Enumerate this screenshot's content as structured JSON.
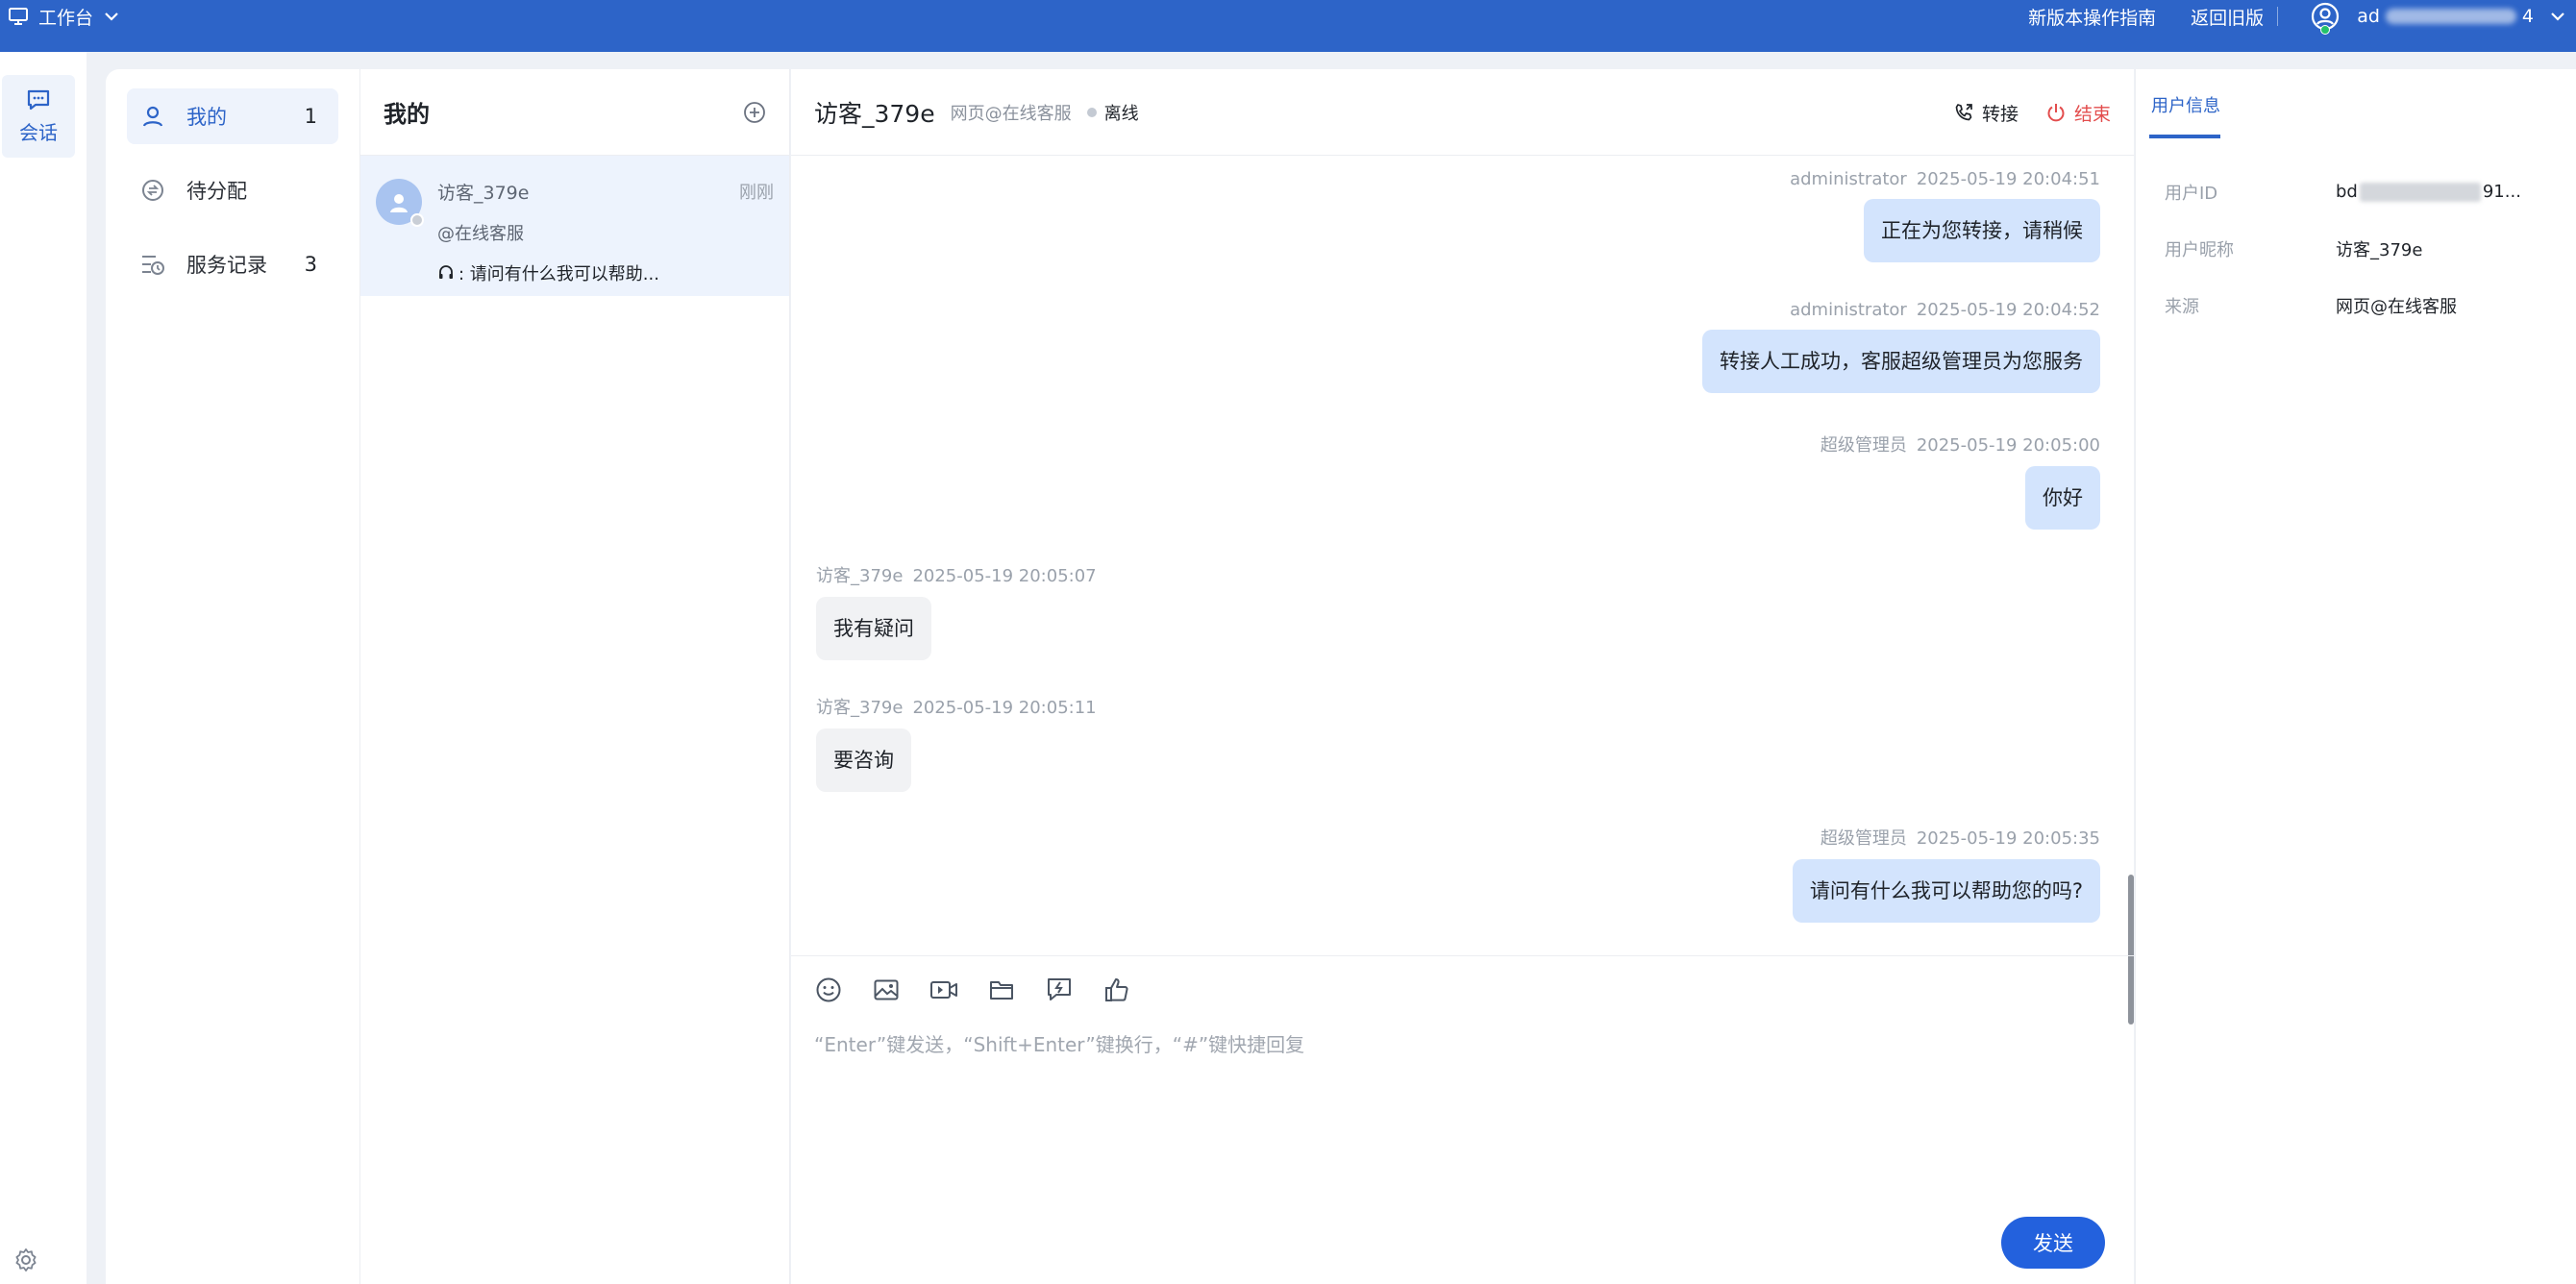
{
  "topbar": {
    "workspace_label": "工作台",
    "guide_link": "新版本操作指南",
    "old_version_link": "返回旧版",
    "user_prefix": "ad",
    "user_suffix": "4"
  },
  "rail": {
    "session_label": "会话"
  },
  "menu": {
    "items": [
      {
        "label": "我的",
        "count": "1",
        "icon": "user-icon"
      },
      {
        "label": "待分配",
        "count": "",
        "icon": "assign-icon"
      },
      {
        "label": "服务记录",
        "count": "3",
        "icon": "history-icon"
      }
    ]
  },
  "conversation_list": {
    "title": "我的",
    "items": [
      {
        "name": "访客_379e",
        "time": "刚刚",
        "channel": "@在线客服",
        "last_message": ": 请问有什么我可以帮助..."
      }
    ]
  },
  "chat": {
    "visitor_name": "访客_379e",
    "channel": "网页@在线客服",
    "status": "离线",
    "transfer_label": "转接",
    "end_label": "结束",
    "messages": [
      {
        "sender": "administrator",
        "time": "2025-05-19 20:04:51",
        "text": "正在为您转接，请稍候",
        "side": "right"
      },
      {
        "sender": "administrator",
        "time": "2025-05-19 20:04:52",
        "text": "转接人工成功，客服超级管理员为您服务",
        "side": "right"
      },
      {
        "sender": "超级管理员",
        "time": "2025-05-19 20:05:00",
        "text": "你好",
        "side": "right"
      },
      {
        "sender": "访客_379e",
        "time": "2025-05-19 20:05:07",
        "text": "我有疑问",
        "side": "left"
      },
      {
        "sender": "访客_379e",
        "time": "2025-05-19 20:05:11",
        "text": "要咨询",
        "side": "left"
      },
      {
        "sender": "超级管理员",
        "time": "2025-05-19 20:05:35",
        "text": "请问有什么我可以帮助您的吗?",
        "side": "right"
      }
    ],
    "composer_placeholder": "“Enter”键发送，“Shift+Enter”键换行，“#”键快捷回复",
    "send_label": "发送"
  },
  "user_info": {
    "tab_label": "用户信息",
    "rows": [
      {
        "label": "用户ID",
        "value_prefix": "bd",
        "value_suffix": "91..."
      },
      {
        "label": "用户昵称",
        "value": "访客_379e"
      },
      {
        "label": "来源",
        "value": "网页@在线客服"
      }
    ]
  },
  "colors": {
    "brand": "#2d64c8",
    "send_button": "#2361dd",
    "end_red": "#e34d4d",
    "online_green": "#23c26b",
    "agent_bubble": "#d3e4fd",
    "visitor_bubble": "#f1f2f4"
  }
}
